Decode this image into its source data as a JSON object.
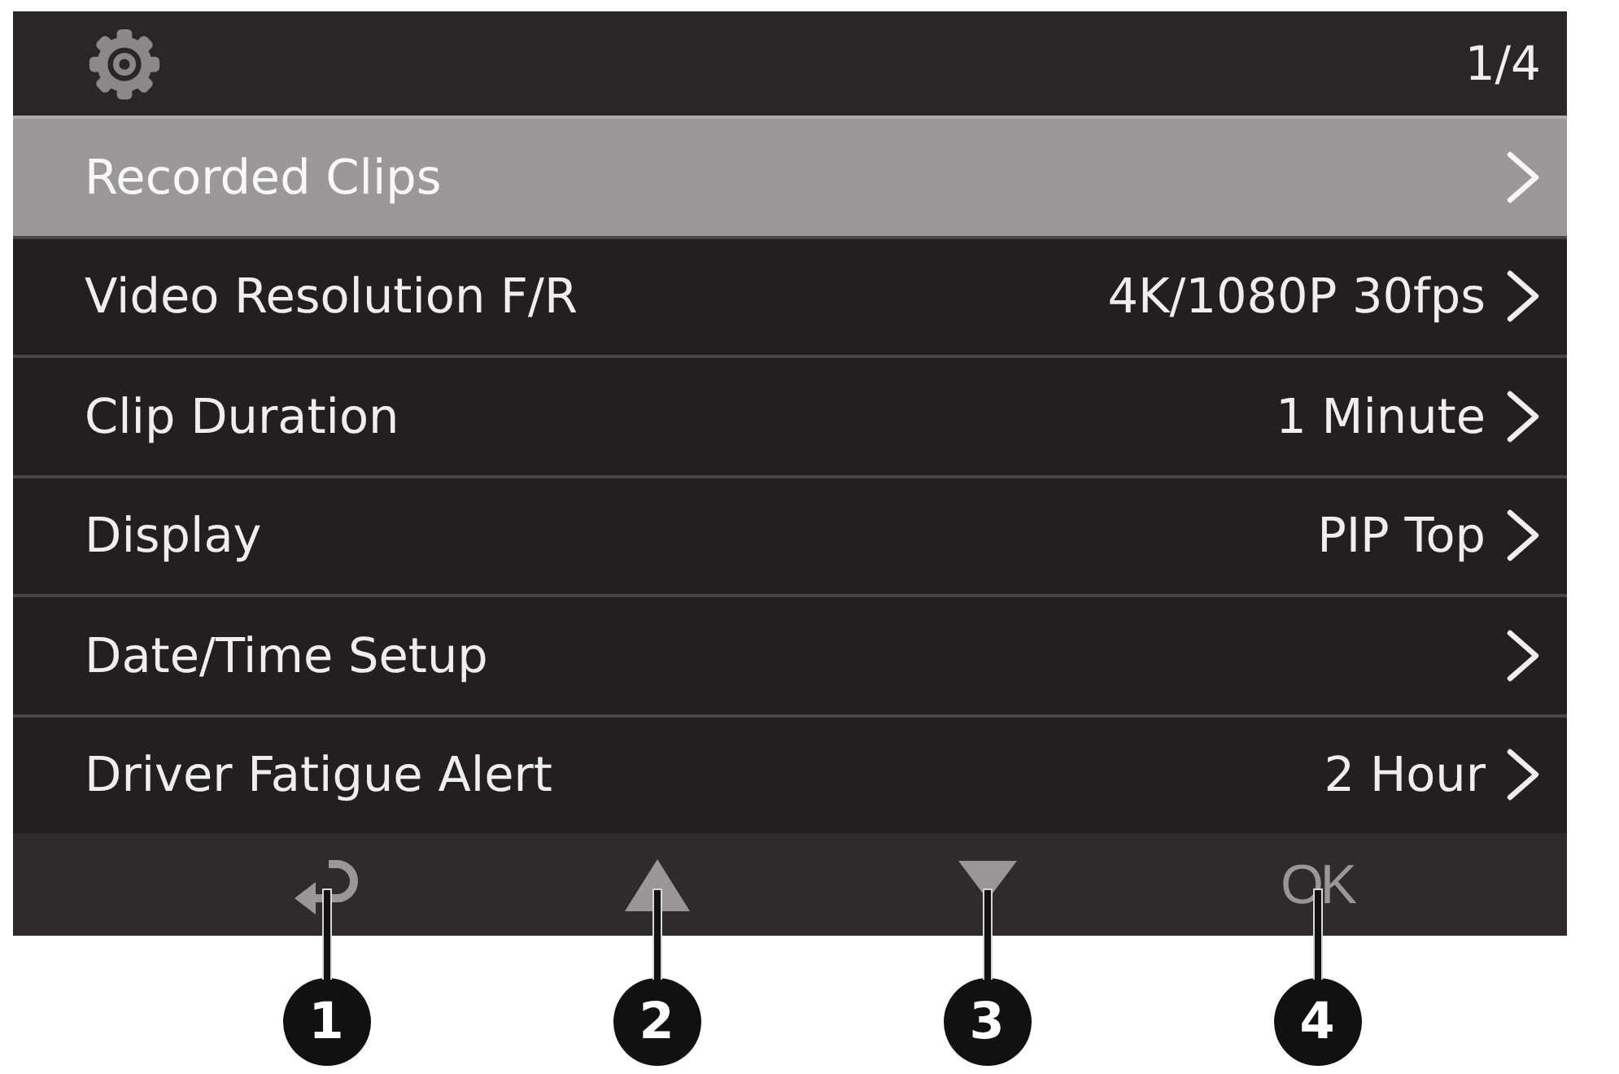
{
  "header": {
    "page": "1/4"
  },
  "menu": [
    {
      "label": "Recorded Clips",
      "selected": true
    },
    {
      "label": "Video Resolution F/R",
      "value": "4K/1080P 30fps",
      "selected": false
    },
    {
      "label": "Clip Duration",
      "value": "1 Minute",
      "selected": false
    },
    {
      "label": "Display",
      "value": "PIP Top",
      "selected": false
    },
    {
      "label": "Date/Time Setup",
      "selected": false
    },
    {
      "label": "Driver Fatigue Alert",
      "value": "2 Hour",
      "selected": false
    }
  ],
  "footer": [
    {
      "kind": "back",
      "callout": "1"
    },
    {
      "kind": "up",
      "callout": "2"
    },
    {
      "kind": "down",
      "callout": "3"
    },
    {
      "kind": "ok",
      "label": "OK",
      "callout": "4"
    }
  ]
}
